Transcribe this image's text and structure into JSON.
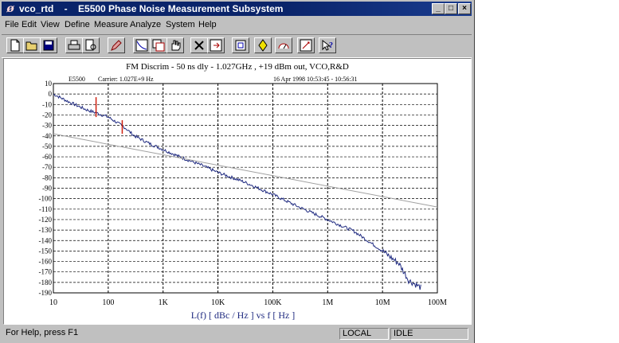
{
  "window": {
    "title": "vco_rtd    -    E5500 Phase Noise Measurement Subsystem",
    "title_icon": "phi-icon"
  },
  "menu": [
    "File",
    "Edit",
    "View",
    "Define",
    "Measure",
    "Analyze",
    "System",
    "Help"
  ],
  "toolbar": [
    "new-file-icon",
    "open-folder-icon",
    "save-disk-icon",
    "print-icon",
    "print-preview-icon",
    "edit-pencil-icon",
    "graph-icon",
    "copy-graph-icon",
    "hand-icon",
    "delete-x-icon",
    "move-icon",
    "frame-icon",
    "diamond-marker-icon",
    "gauge-icon",
    "settings-icon",
    "help-cursor-icon"
  ],
  "plot": {
    "title": "FM Discrim - 50 ns dly - 1.027GHz ,  +19 dBm out, VCO,R&D",
    "inst": "E5500",
    "carrier": "Carrier: 1.027E+9 Hz",
    "date": "16 Apr 1998   10:53:45 - 10:56:31",
    "xlabel": "L(f)  [ dBc / Hz ]   vs   f  [ Hz ]",
    "y_ticks": [
      "10",
      "0",
      "-10",
      "-20",
      "-30",
      "-40",
      "-50",
      "-60",
      "-70",
      "-80",
      "-90",
      "-100",
      "-110",
      "-120",
      "-130",
      "-140",
      "-150",
      "-160",
      "-170",
      "-180",
      "-190"
    ],
    "x_ticks": [
      "10",
      "100",
      "1K",
      "10K",
      "100K",
      "1M",
      "10M",
      "100M"
    ],
    "colors": {
      "trace": "#1f2a80",
      "spur": "#d02010",
      "ref": "#a0a0a0",
      "grid": "#000000"
    }
  },
  "chart_data": {
    "type": "line",
    "title": "FM Discrim - 50 ns dly - 1.027GHz ,  +19 dBm out, VCO,R&D",
    "xlabel": "L(f)  [ dBc / Hz ]   vs   f  [ Hz ]",
    "ylabel": "",
    "x_scale": "log",
    "xlim": [
      10,
      100000000
    ],
    "ylim": [
      -190,
      10
    ],
    "grid": true,
    "series": [
      {
        "x": [
          10,
          20,
          40,
          60,
          100,
          200,
          300,
          600,
          1000,
          2000,
          5000,
          10000,
          30000,
          100000,
          300000,
          1000000,
          3000000,
          10000000,
          20000000,
          30000000,
          50000000
        ],
        "y": [
          0,
          -8,
          -15,
          -18,
          -22,
          -32,
          -40,
          -48,
          -53,
          -60,
          -68,
          -75,
          -84,
          -96,
          -108,
          -120,
          -131,
          -150,
          -162,
          -178,
          -185
        ]
      },
      {
        "x": [
          10,
          100000000
        ],
        "y": [
          -38,
          -108
        ]
      },
      {
        "x": [
          60,
          60,
          180,
          180
        ],
        "y": [
          -3,
          -22,
          -25,
          -38
        ]
      }
    ]
  },
  "status": {
    "help": "For Help, press F1",
    "mode": "LOCAL",
    "state": "IDLE"
  }
}
